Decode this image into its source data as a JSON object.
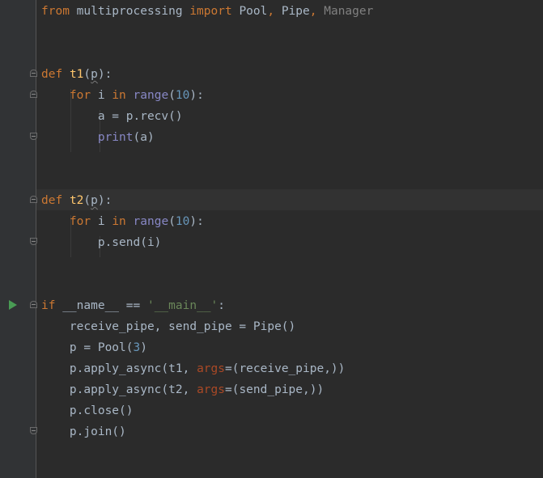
{
  "code": {
    "l1": {
      "kw_from": "from",
      "module": " multiprocessing ",
      "kw_import": "import",
      "sp1": " ",
      "name_pool": "Pool",
      "comma1": ", ",
      "name_pipe": "Pipe",
      "comma2": ", ",
      "name_manager": "Manager"
    },
    "l4": {
      "kw": "def",
      "sp": " ",
      "fname": "t1",
      "open": "(",
      "param": "p",
      "close": "):"
    },
    "l5": {
      "indent": "    ",
      "kw_for": "for",
      "mid": " i ",
      "kw_in": "in",
      "sp": " ",
      "range": "range",
      "open": "(",
      "num": "10",
      "close": "):"
    },
    "l6": {
      "text": "        a = p.recv()"
    },
    "l7": {
      "indent": "        ",
      "print": "print",
      "rest": "(a)"
    },
    "l10": {
      "kw": "def",
      "sp": " ",
      "fname": "t2",
      "open": "(",
      "param": "p",
      "close": "):"
    },
    "l11": {
      "indent": "    ",
      "kw_for": "for",
      "mid": " i ",
      "kw_in": "in",
      "sp": " ",
      "range": "range",
      "open": "(",
      "num": "10",
      "close": "):"
    },
    "l12": {
      "text": "        p.send(i)"
    },
    "l15": {
      "kw": "if",
      "mid": " __name__ == ",
      "str": "'__main__'",
      "end": ":"
    },
    "l16": {
      "text": "    receive_pipe, send_pipe = Pipe()"
    },
    "l17": {
      "pre": "    p = Pool(",
      "num": "3",
      "post": ")"
    },
    "l18": {
      "pre": "    p.apply_async(t1, ",
      "kwarg": "args",
      "post": "=(receive_pipe,))"
    },
    "l19": {
      "pre": "    p.apply_async(t2, ",
      "kwarg": "args",
      "post": "=(send_pipe,))"
    },
    "l20": {
      "text": "    p.close()"
    },
    "l21": {
      "text": "    p.join()"
    }
  },
  "colors": {
    "background": "#2b2b2b",
    "gutter": "#313335",
    "keyword": "#cc7832",
    "function_name": "#ffc66d",
    "builtin": "#8888c6",
    "number": "#6897bb",
    "string": "#6a8759",
    "unused_import": "#808080",
    "keyword_argument": "#aa4926",
    "default_text": "#a9b7c6",
    "run_arrow": "#499c54"
  },
  "icons": {
    "run": "run-arrow-icon",
    "fold": "fold-marker-icon"
  }
}
